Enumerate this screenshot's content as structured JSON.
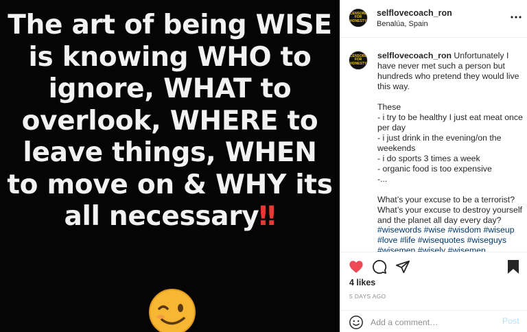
{
  "image": {
    "quote_lines": [
      "The art of being WISE",
      "is knowing WHO to",
      "ignore, WHAT to",
      "overlook, WHERE to",
      "leave things, WHEN",
      "to move on & WHY its",
      "all necessary"
    ],
    "quote_bangs": "‼",
    "emoji": "winking-face"
  },
  "header": {
    "username": "selflovecoach_ron",
    "location": "Benalúa, Spain",
    "avatar_text": "CENSORED FOR HONESTY"
  },
  "caption": {
    "username": "selflovecoach_ron",
    "text": " Unfortunately I have never met such a person but hundreds who pretend they would live this way.\n\nThese\n- i try to be healthy I just eat meat once per day\n- i just drink in the evening/on the weekends\n- i do sports 3 times a week\n- organic food is too expensive\n-...\n\nWhat’s your excuse to be a terrorist? What’s your excuse to destroy yourself and the planet all day every day?",
    "hashtags": "#wisewords #wise #wisdom #wiseup #love #life #wisequotes #wiseguys #wisemen #wisely #wisemen"
  },
  "actions": {
    "likes": "4 likes",
    "timestamp": "5 DAYS AGO",
    "like_color": "#ed4956",
    "icons": [
      "heart-icon",
      "comment-icon",
      "share-icon",
      "bookmark-icon"
    ]
  },
  "comment": {
    "placeholder": "Add a comment…",
    "post_label": "Post",
    "post_color": "#b2dffc"
  }
}
